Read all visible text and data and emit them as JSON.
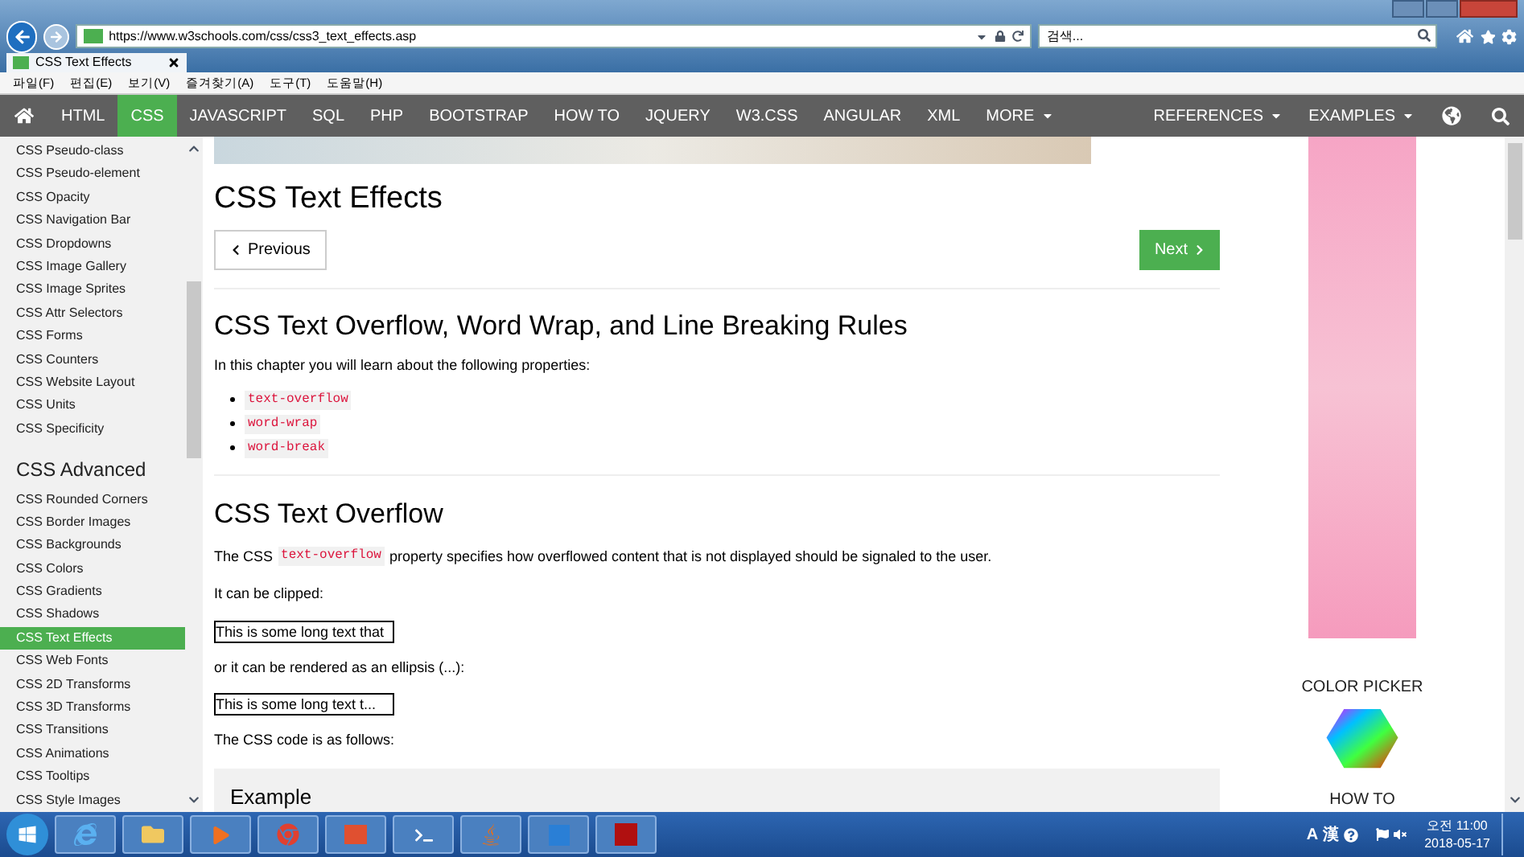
{
  "browser": {
    "url": "https://www.w3schools.com/css/css3_text_effects.asp",
    "search_placeholder": "검색...",
    "tab_title": "CSS Text Effects",
    "menu": [
      "파일(F)",
      "편집(E)",
      "보기(V)",
      "즐겨찾기(A)",
      "도구(T)",
      "도움말(H)"
    ]
  },
  "nav": {
    "items": [
      {
        "label": "HTML",
        "selected": false,
        "dropdown": false
      },
      {
        "label": "CSS",
        "selected": true,
        "dropdown": false
      },
      {
        "label": "JAVASCRIPT",
        "selected": false,
        "dropdown": false
      },
      {
        "label": "SQL",
        "selected": false,
        "dropdown": false
      },
      {
        "label": "PHP",
        "selected": false,
        "dropdown": false
      },
      {
        "label": "BOOTSTRAP",
        "selected": false,
        "dropdown": false
      },
      {
        "label": "HOW TO",
        "selected": false,
        "dropdown": false
      },
      {
        "label": "JQUERY",
        "selected": false,
        "dropdown": false
      },
      {
        "label": "W3.CSS",
        "selected": false,
        "dropdown": false
      },
      {
        "label": "ANGULAR",
        "selected": false,
        "dropdown": false
      },
      {
        "label": "XML",
        "selected": false,
        "dropdown": false
      },
      {
        "label": "MORE",
        "selected": false,
        "dropdown": true
      }
    ],
    "right": [
      {
        "label": "REFERENCES",
        "dropdown": true
      },
      {
        "label": "EXAMPLES",
        "dropdown": true
      }
    ]
  },
  "sidebar": [
    {
      "kind": "link",
      "label": "CSS Pseudo-class",
      "selected": false
    },
    {
      "kind": "link",
      "label": "CSS Pseudo-element",
      "selected": false
    },
    {
      "kind": "link",
      "label": "CSS Opacity",
      "selected": false
    },
    {
      "kind": "link",
      "label": "CSS Navigation Bar",
      "selected": false
    },
    {
      "kind": "link",
      "label": "CSS Dropdowns",
      "selected": false
    },
    {
      "kind": "link",
      "label": "CSS Image Gallery",
      "selected": false
    },
    {
      "kind": "link",
      "label": "CSS Image Sprites",
      "selected": false
    },
    {
      "kind": "link",
      "label": "CSS Attr Selectors",
      "selected": false
    },
    {
      "kind": "link",
      "label": "CSS Forms",
      "selected": false
    },
    {
      "kind": "link",
      "label": "CSS Counters",
      "selected": false
    },
    {
      "kind": "link",
      "label": "CSS Website Layout",
      "selected": false
    },
    {
      "kind": "link",
      "label": "CSS Units",
      "selected": false
    },
    {
      "kind": "link",
      "label": "CSS Specificity",
      "selected": false
    },
    {
      "kind": "heading",
      "label": "CSS Advanced"
    },
    {
      "kind": "link",
      "label": "CSS Rounded Corners",
      "selected": false
    },
    {
      "kind": "link",
      "label": "CSS Border Images",
      "selected": false
    },
    {
      "kind": "link",
      "label": "CSS Backgrounds",
      "selected": false
    },
    {
      "kind": "link",
      "label": "CSS Colors",
      "selected": false
    },
    {
      "kind": "link",
      "label": "CSS Gradients",
      "selected": false
    },
    {
      "kind": "link",
      "label": "CSS Shadows",
      "selected": false
    },
    {
      "kind": "link",
      "label": "CSS Text Effects",
      "selected": true
    },
    {
      "kind": "link",
      "label": "CSS Web Fonts",
      "selected": false
    },
    {
      "kind": "link",
      "label": "CSS 2D Transforms",
      "selected": false
    },
    {
      "kind": "link",
      "label": "CSS 3D Transforms",
      "selected": false
    },
    {
      "kind": "link",
      "label": "CSS Transitions",
      "selected": false
    },
    {
      "kind": "link",
      "label": "CSS Animations",
      "selected": false
    },
    {
      "kind": "link",
      "label": "CSS Tooltips",
      "selected": false
    },
    {
      "kind": "link",
      "label": "CSS Style Images",
      "selected": false
    }
  ],
  "main": {
    "title": "CSS Text Effects",
    "previous": "Previous",
    "next": "Next",
    "h2_a": "CSS Text Overflow, Word Wrap, and Line Breaking Rules",
    "intro": "In this chapter you will learn about the following properties:",
    "properties": [
      "text-overflow",
      "word-wrap",
      "word-break"
    ],
    "h2_b": "CSS Text Overflow",
    "desc_before": "The CSS",
    "desc_code": "text-overflow",
    "desc_after": "property specifies how overflowed content that is not displayed should be signaled to the user.",
    "clipped_label": "It can be clipped:",
    "clipped_demo": "This is some long text that",
    "ellipsis_label": "or it can be rendered as an ellipsis (...):",
    "ellipsis_demo": "This is some long text t...",
    "code_label": "The CSS code is as follows:",
    "example_title": "Example"
  },
  "right": {
    "color_picker": "COLOR PICKER",
    "how_to": "HOW TO"
  },
  "taskbar": {
    "ime": [
      "A",
      "漢"
    ],
    "time": "오전 11:00",
    "date": "2018-05-17"
  }
}
